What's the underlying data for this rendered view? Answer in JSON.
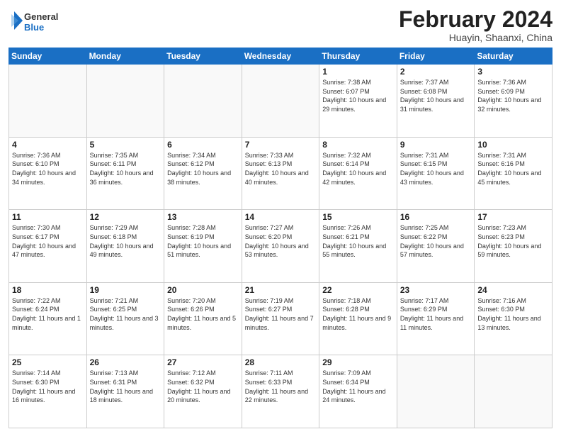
{
  "header": {
    "logo_general": "General",
    "logo_blue": "Blue",
    "title": "February 2024",
    "location": "Huayin, Shaanxi, China"
  },
  "days_of_week": [
    "Sunday",
    "Monday",
    "Tuesday",
    "Wednesday",
    "Thursday",
    "Friday",
    "Saturday"
  ],
  "weeks": [
    [
      {
        "day": "",
        "info": ""
      },
      {
        "day": "",
        "info": ""
      },
      {
        "day": "",
        "info": ""
      },
      {
        "day": "",
        "info": ""
      },
      {
        "day": "1",
        "info": "Sunrise: 7:38 AM\nSunset: 6:07 PM\nDaylight: 10 hours and 29 minutes."
      },
      {
        "day": "2",
        "info": "Sunrise: 7:37 AM\nSunset: 6:08 PM\nDaylight: 10 hours and 31 minutes."
      },
      {
        "day": "3",
        "info": "Sunrise: 7:36 AM\nSunset: 6:09 PM\nDaylight: 10 hours and 32 minutes."
      }
    ],
    [
      {
        "day": "4",
        "info": "Sunrise: 7:36 AM\nSunset: 6:10 PM\nDaylight: 10 hours and 34 minutes."
      },
      {
        "day": "5",
        "info": "Sunrise: 7:35 AM\nSunset: 6:11 PM\nDaylight: 10 hours and 36 minutes."
      },
      {
        "day": "6",
        "info": "Sunrise: 7:34 AM\nSunset: 6:12 PM\nDaylight: 10 hours and 38 minutes."
      },
      {
        "day": "7",
        "info": "Sunrise: 7:33 AM\nSunset: 6:13 PM\nDaylight: 10 hours and 40 minutes."
      },
      {
        "day": "8",
        "info": "Sunrise: 7:32 AM\nSunset: 6:14 PM\nDaylight: 10 hours and 42 minutes."
      },
      {
        "day": "9",
        "info": "Sunrise: 7:31 AM\nSunset: 6:15 PM\nDaylight: 10 hours and 43 minutes."
      },
      {
        "day": "10",
        "info": "Sunrise: 7:31 AM\nSunset: 6:16 PM\nDaylight: 10 hours and 45 minutes."
      }
    ],
    [
      {
        "day": "11",
        "info": "Sunrise: 7:30 AM\nSunset: 6:17 PM\nDaylight: 10 hours and 47 minutes."
      },
      {
        "day": "12",
        "info": "Sunrise: 7:29 AM\nSunset: 6:18 PM\nDaylight: 10 hours and 49 minutes."
      },
      {
        "day": "13",
        "info": "Sunrise: 7:28 AM\nSunset: 6:19 PM\nDaylight: 10 hours and 51 minutes."
      },
      {
        "day": "14",
        "info": "Sunrise: 7:27 AM\nSunset: 6:20 PM\nDaylight: 10 hours and 53 minutes."
      },
      {
        "day": "15",
        "info": "Sunrise: 7:26 AM\nSunset: 6:21 PM\nDaylight: 10 hours and 55 minutes."
      },
      {
        "day": "16",
        "info": "Sunrise: 7:25 AM\nSunset: 6:22 PM\nDaylight: 10 hours and 57 minutes."
      },
      {
        "day": "17",
        "info": "Sunrise: 7:23 AM\nSunset: 6:23 PM\nDaylight: 10 hours and 59 minutes."
      }
    ],
    [
      {
        "day": "18",
        "info": "Sunrise: 7:22 AM\nSunset: 6:24 PM\nDaylight: 11 hours and 1 minute."
      },
      {
        "day": "19",
        "info": "Sunrise: 7:21 AM\nSunset: 6:25 PM\nDaylight: 11 hours and 3 minutes."
      },
      {
        "day": "20",
        "info": "Sunrise: 7:20 AM\nSunset: 6:26 PM\nDaylight: 11 hours and 5 minutes."
      },
      {
        "day": "21",
        "info": "Sunrise: 7:19 AM\nSunset: 6:27 PM\nDaylight: 11 hours and 7 minutes."
      },
      {
        "day": "22",
        "info": "Sunrise: 7:18 AM\nSunset: 6:28 PM\nDaylight: 11 hours and 9 minutes."
      },
      {
        "day": "23",
        "info": "Sunrise: 7:17 AM\nSunset: 6:29 PM\nDaylight: 11 hours and 11 minutes."
      },
      {
        "day": "24",
        "info": "Sunrise: 7:16 AM\nSunset: 6:30 PM\nDaylight: 11 hours and 13 minutes."
      }
    ],
    [
      {
        "day": "25",
        "info": "Sunrise: 7:14 AM\nSunset: 6:30 PM\nDaylight: 11 hours and 16 minutes."
      },
      {
        "day": "26",
        "info": "Sunrise: 7:13 AM\nSunset: 6:31 PM\nDaylight: 11 hours and 18 minutes."
      },
      {
        "day": "27",
        "info": "Sunrise: 7:12 AM\nSunset: 6:32 PM\nDaylight: 11 hours and 20 minutes."
      },
      {
        "day": "28",
        "info": "Sunrise: 7:11 AM\nSunset: 6:33 PM\nDaylight: 11 hours and 22 minutes."
      },
      {
        "day": "29",
        "info": "Sunrise: 7:09 AM\nSunset: 6:34 PM\nDaylight: 11 hours and 24 minutes."
      },
      {
        "day": "",
        "info": ""
      },
      {
        "day": "",
        "info": ""
      }
    ]
  ]
}
